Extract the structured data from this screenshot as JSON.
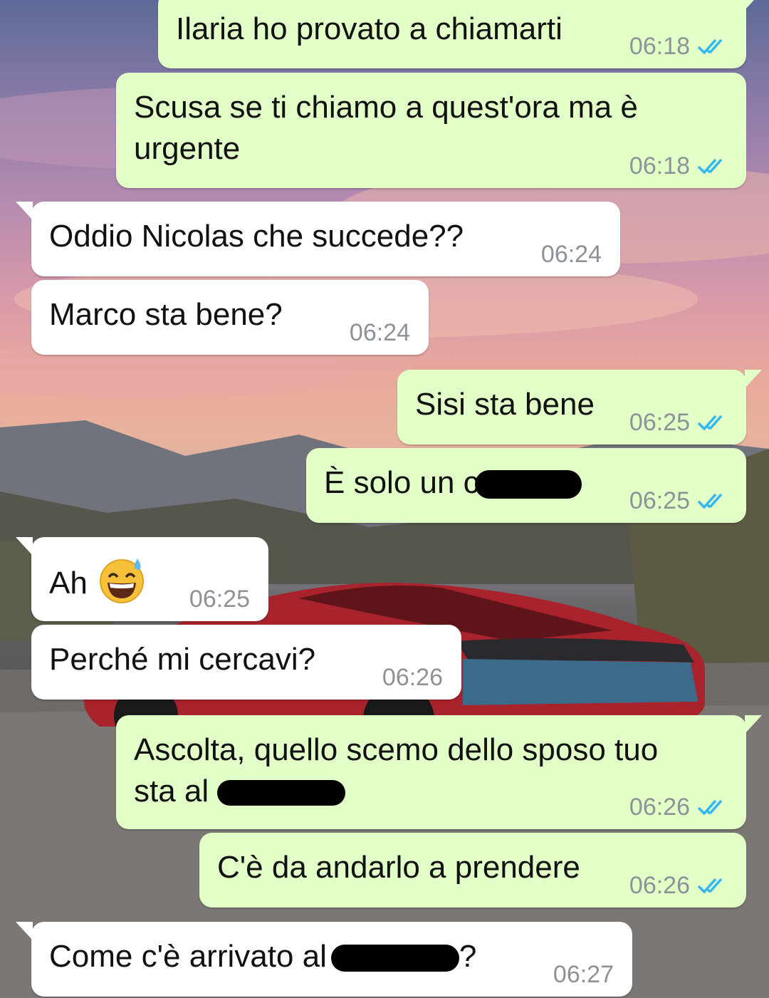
{
  "messages": [
    {
      "text": "Ilaria ho provato a chiamarti",
      "time": "06:18"
    },
    {
      "text": "Scusa se ti chiamo a quest'ora ma è urgente",
      "time": "06:18"
    },
    {
      "text": "Oddio Nicolas che succede??",
      "time": "06:24"
    },
    {
      "text": "Marco sta bene?",
      "time": "06:24"
    },
    {
      "text": "Sisi sta bene",
      "time": "06:25"
    },
    {
      "text": "È solo un c",
      "time": "06:25"
    },
    {
      "text": "Ah",
      "time": "06:25",
      "emoji": "grinning-face-with-sweat"
    },
    {
      "text": "Perché mi cercavi?",
      "time": "06:26"
    },
    {
      "text_line1": "Ascolta, quello scemo dello sposo tuo",
      "text_line2": "sta al",
      "time": "06:26"
    },
    {
      "text": "C'è da andarlo a prendere",
      "time": "06:26"
    },
    {
      "text_before": "Come c'è arrivato al",
      "text_after": "?",
      "time": "06:27"
    }
  ],
  "colors": {
    "outgoing_bubble": "#e2ffc8",
    "incoming_bubble": "#ffffff",
    "read_ticks": "#34b7f1",
    "time_text": "#8d9298"
  }
}
